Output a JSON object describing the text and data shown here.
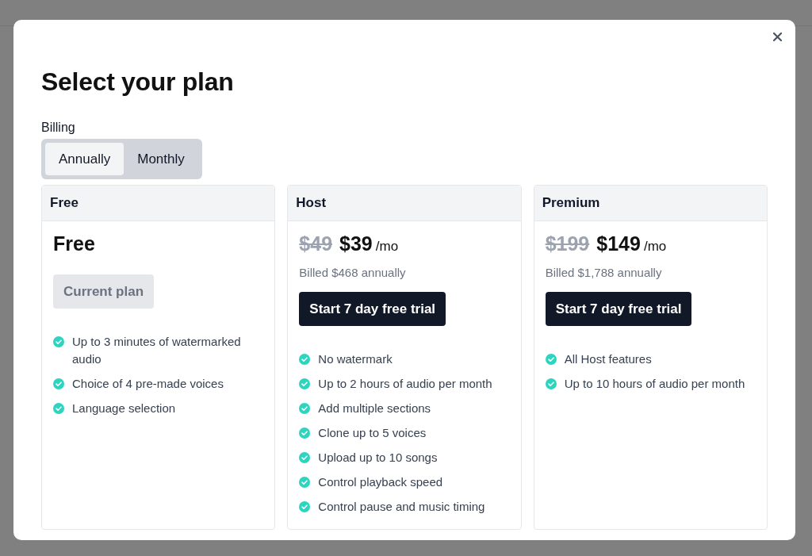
{
  "dialog": {
    "title": "Select your plan"
  },
  "billing": {
    "label": "Billing",
    "options": [
      {
        "label": "Annually",
        "selected": true
      },
      {
        "label": "Monthly",
        "selected": false
      }
    ]
  },
  "plans": [
    {
      "name": "Free",
      "price": "Free",
      "button": {
        "label": "Current plan",
        "disabled": true
      },
      "features": [
        "Up to 3 minutes of watermarked audio",
        "Choice of 4 pre-made voices",
        "Language selection"
      ]
    },
    {
      "name": "Host",
      "original_price": "$49",
      "price": "$39",
      "period": "/mo",
      "billed": "Billed $468 annually",
      "button": {
        "label": "Start 7 day free trial",
        "disabled": false
      },
      "features": [
        "No watermark",
        "Up to 2 hours of audio per month",
        "Add multiple sections",
        "Clone up to 5 voices",
        "Upload up to 10 songs",
        "Control playback speed",
        "Control pause and music timing"
      ]
    },
    {
      "name": "Premium",
      "original_price": "$199",
      "price": "$149",
      "period": "/mo",
      "billed": "Billed $1,788 annually",
      "button": {
        "label": "Start 7 day free trial",
        "disabled": false
      },
      "features": [
        "All Host features",
        "Up to 10 hours of audio per month"
      ]
    }
  ]
}
